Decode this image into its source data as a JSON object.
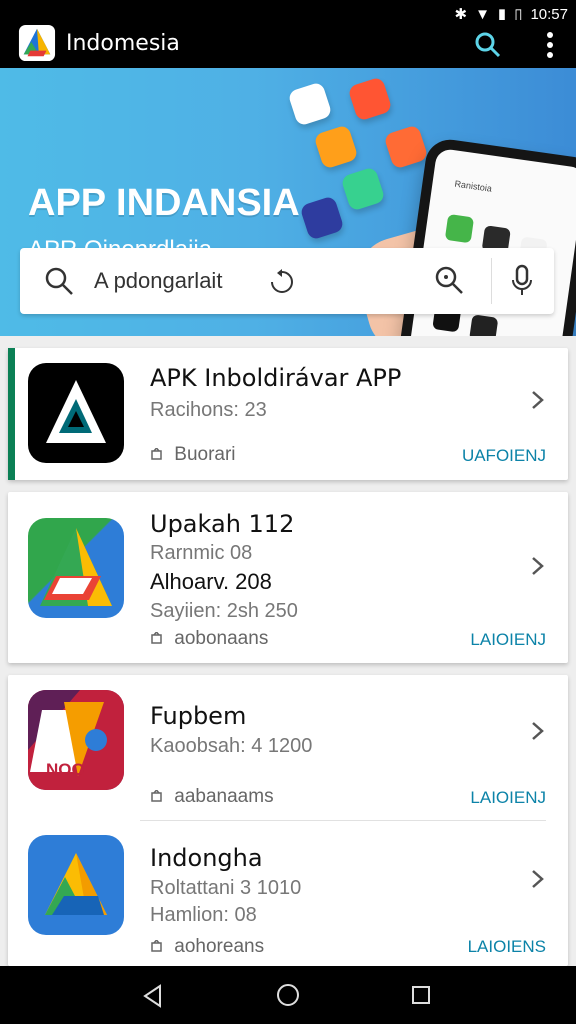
{
  "status": {
    "time": "10:57",
    "icons": [
      "bluetooth-icon",
      "wifi-icon",
      "signal-icon",
      "vibrate-icon"
    ]
  },
  "appbar": {
    "title": "Indomesia",
    "search_icon": "search-icon",
    "menu_icon": "more-vert-icon"
  },
  "banner": {
    "title": "APP INDANSIA",
    "subtitle": "APR Oinenrdlaiia",
    "phone_label": "Ranistoia"
  },
  "search": {
    "placeholder": "A  pdongarlait",
    "icons": [
      "search-icon",
      "app-store-icon",
      "refresh-icon",
      "zoom-icon",
      "microphone-icon"
    ]
  },
  "apps": [
    {
      "name": "APK Inboldirávar APP",
      "meta1": "Racihons: 23",
      "tag": "Buorari",
      "action": "UAFOIENJ",
      "icon_colors": [
        "#000000",
        "#ffffff",
        "#006a77"
      ]
    },
    {
      "name": "Upakah 112",
      "meta1": "Rarnmic 08",
      "meta2": "Alhoarv. 208",
      "meta3": "Sayiien:  2sh 250",
      "tag": "aobonaans",
      "action": "LAIOIENJ",
      "icon_colors": [
        "#2e7dd7",
        "#34a853",
        "#fbbc04",
        "#ea4335"
      ]
    },
    {
      "name": "Fupbem",
      "meta1": "Kaoobsah:  4 1200",
      "tag": "aabanaams",
      "action": "LAIOIENJ",
      "icon_colors": [
        "#5f1f56",
        "#f59d00",
        "#d12d3a",
        "#ffffff"
      ]
    },
    {
      "name": "Indongha",
      "meta1": "Roltattani  3 1010",
      "meta2": "Hamlion: 08",
      "tag": "aohoreans",
      "action": "LAIOIENS",
      "icon_colors": [
        "#2e7dd7",
        "#34a853",
        "#fbbc04"
      ]
    }
  ],
  "nav": {
    "back": "back-icon",
    "home": "home-icon",
    "recent": "recent-apps-icon"
  },
  "colors": {
    "accent": "#0c83a8",
    "green_accent": "#0b8055",
    "banner": "#4fbbe7"
  }
}
